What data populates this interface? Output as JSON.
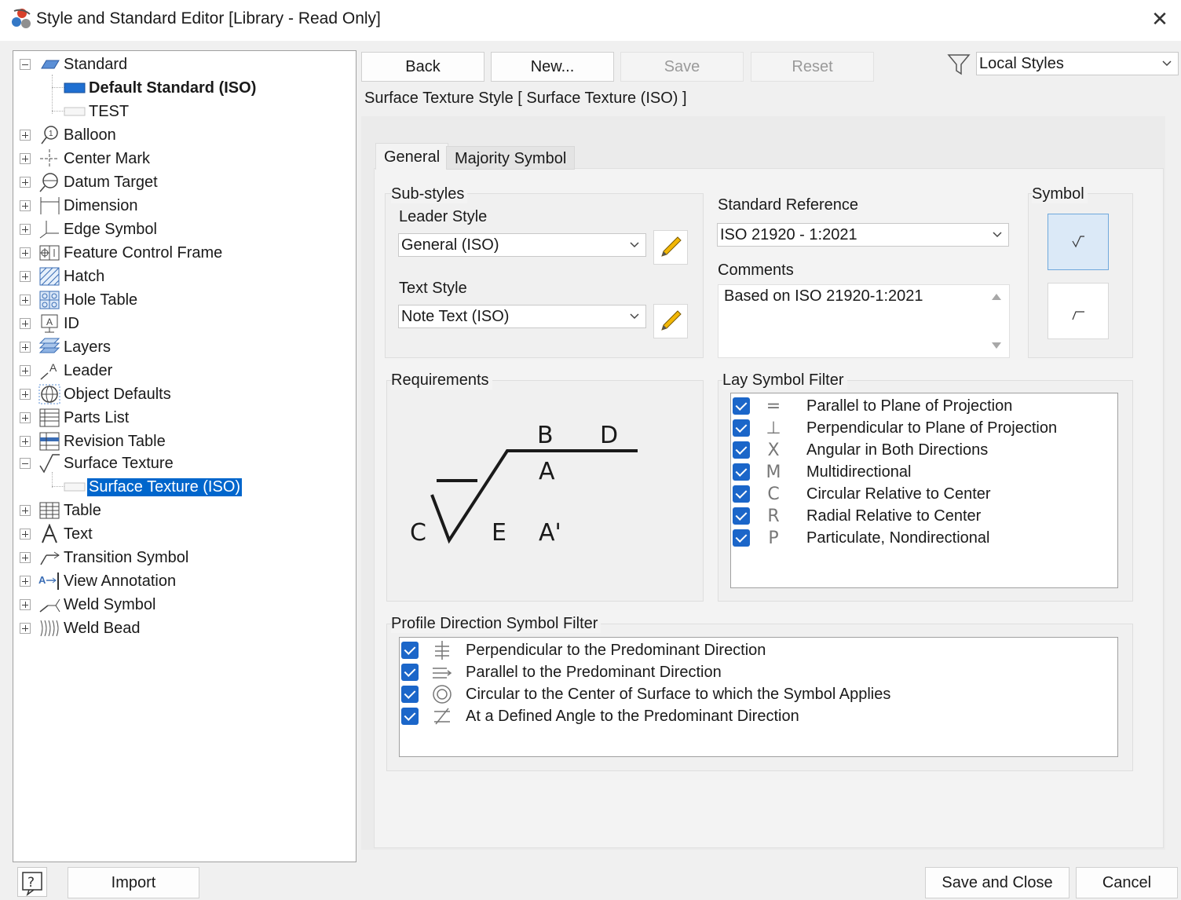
{
  "window": {
    "title": "Style and Standard Editor [Library - Read Only]",
    "close_label": "✕"
  },
  "tree": {
    "items": [
      {
        "label": "Standard",
        "icon": "standard-icon"
      },
      {
        "label": "Default Standard (ISO)",
        "icon": "default-standard-icon"
      },
      {
        "label": "TEST",
        "icon": "standard-sheet-icon"
      },
      {
        "label": "Balloon",
        "icon": "balloon-icon"
      },
      {
        "label": "Center Mark",
        "icon": "center-mark-icon"
      },
      {
        "label": "Datum Target",
        "icon": "datum-target-icon"
      },
      {
        "label": "Dimension",
        "icon": "dimension-icon"
      },
      {
        "label": "Edge Symbol",
        "icon": "edge-symbol-icon"
      },
      {
        "label": "Feature Control Frame",
        "icon": "feature-control-frame-icon"
      },
      {
        "label": "Hatch",
        "icon": "hatch-icon"
      },
      {
        "label": "Hole Table",
        "icon": "hole-table-icon"
      },
      {
        "label": "ID",
        "icon": "id-icon"
      },
      {
        "label": "Layers",
        "icon": "layers-icon"
      },
      {
        "label": "Leader",
        "icon": "leader-icon"
      },
      {
        "label": "Object Defaults",
        "icon": "object-defaults-icon"
      },
      {
        "label": "Parts List",
        "icon": "parts-list-icon"
      },
      {
        "label": "Revision Table",
        "icon": "revision-table-icon"
      },
      {
        "label": "Surface Texture",
        "icon": "surface-texture-icon"
      },
      {
        "label": "Surface Texture (ISO)",
        "icon": "surface-texture-style-icon"
      },
      {
        "label": "Table",
        "icon": "table-icon"
      },
      {
        "label": "Text",
        "icon": "text-icon"
      },
      {
        "label": "Transition Symbol",
        "icon": "transition-symbol-icon"
      },
      {
        "label": "View Annotation",
        "icon": "view-annotation-icon"
      },
      {
        "label": "Weld Symbol",
        "icon": "weld-symbol-icon"
      },
      {
        "label": "Weld Bead",
        "icon": "weld-bead-icon"
      }
    ]
  },
  "toolbar": {
    "back_label": "Back",
    "new_label": "New...",
    "save_label": "Save",
    "reset_label": "Reset",
    "filter_value": "Local Styles"
  },
  "style_title": "Surface Texture Style [ Surface Texture (ISO) ]",
  "tabs": {
    "general": "General",
    "majority": "Majority Symbol"
  },
  "substyles": {
    "group_label": "Sub-styles",
    "leader_label": "Leader Style",
    "leader_value": "General (ISO)",
    "text_label": "Text Style",
    "text_value": "Note Text (ISO)"
  },
  "standard_reference": {
    "label": "Standard Reference",
    "value": "ISO 21920 - 1:2021"
  },
  "comments": {
    "label": "Comments",
    "value": "Based on ISO 21920-1:2021"
  },
  "symbol": {
    "group_label": "Symbol"
  },
  "requirements": {
    "group_label": "Requirements",
    "letters": {
      "b": "B",
      "d": "D",
      "a": "A",
      "c": "C",
      "e": "E",
      "a_prime": "A'"
    }
  },
  "lay_filter": {
    "group_label": "Lay Symbol Filter",
    "items": [
      {
        "glyph": "=",
        "label": "Parallel to Plane of Projection"
      },
      {
        "glyph": "⊥",
        "label": "Perpendicular to Plane of Projection"
      },
      {
        "glyph": "X",
        "label": "Angular in Both Directions"
      },
      {
        "glyph": "M",
        "label": "Multidirectional"
      },
      {
        "glyph": "C",
        "label": "Circular Relative to Center"
      },
      {
        "glyph": "R",
        "label": "Radial Relative to Center"
      },
      {
        "glyph": "P",
        "label": "Particulate, Nondirectional"
      }
    ]
  },
  "profile_filter": {
    "group_label": "Profile Direction Symbol Filter",
    "items": [
      {
        "label": "Perpendicular to the Predominant Direction"
      },
      {
        "label": "Parallel to the Predominant Direction"
      },
      {
        "label": "Circular to the Center of Surface to which the Symbol Applies"
      },
      {
        "label": "At a Defined Angle to the Predominant Direction"
      }
    ]
  },
  "footer": {
    "help_label": "?",
    "import_label": "Import",
    "save_close_label": "Save and Close",
    "cancel_label": "Cancel"
  },
  "colors": {
    "selection": "#0066cc",
    "checkbox": "#1b66c9",
    "active_tile": "#dbe9f7"
  }
}
